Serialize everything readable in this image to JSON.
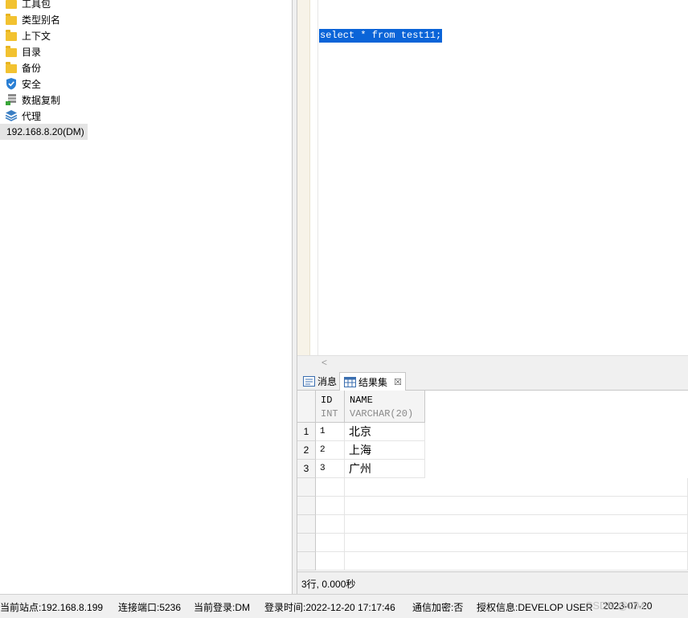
{
  "tree": {
    "items": [
      {
        "label": "工具包",
        "icon": "folder-icon"
      },
      {
        "label": "类型别名",
        "icon": "folder-icon"
      },
      {
        "label": "上下文",
        "icon": "folder-icon"
      },
      {
        "label": "目录",
        "icon": "folder-icon"
      },
      {
        "label": "备份",
        "icon": "folder-icon"
      },
      {
        "label": "安全",
        "icon": "shield-icon"
      },
      {
        "label": "数据复制",
        "icon": "replication-icon"
      },
      {
        "label": "代理",
        "icon": "layers-icon"
      }
    ],
    "connection": "192.168.8.20(DM)"
  },
  "editor": {
    "sql": "select * from test11;"
  },
  "result_tabs": {
    "messages": "消息",
    "result_set": "结果集",
    "close_glyph": "☒"
  },
  "grid": {
    "columns": [
      {
        "name": "ID",
        "type": "INT"
      },
      {
        "name": "NAME",
        "type": "VARCHAR(20)"
      }
    ],
    "rows": [
      {
        "num": "1",
        "id": "1",
        "name": "北京"
      },
      {
        "num": "2",
        "id": "2",
        "name": "上海"
      },
      {
        "num": "3",
        "id": "3",
        "name": "广州"
      }
    ],
    "footer": "3行, 0.000秒"
  },
  "statusbar": {
    "site": "当前站点:192.168.8.199",
    "port": "连接端口:5236",
    "login": "当前登录:DM",
    "login_time": "登录时间:2022-12-20 17:17:46",
    "encryption": "通信加密:否",
    "license": "授权信息:DEVELOP USER",
    "expiry": "2023-07-20",
    "watermark": "CSDN @DM"
  },
  "colors": {
    "selection": "#0a64d8",
    "folder": "#f2c230",
    "shield": "#2a7fd4"
  }
}
